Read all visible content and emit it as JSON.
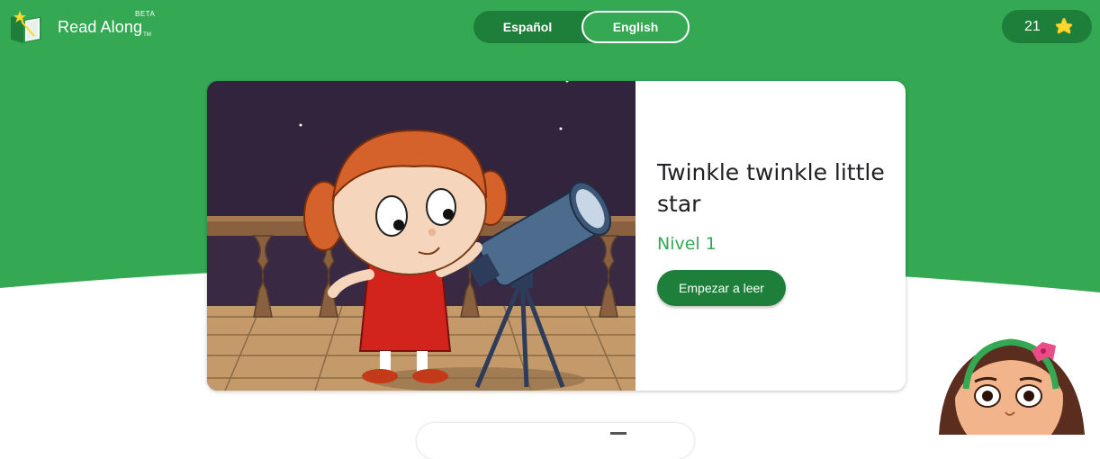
{
  "app": {
    "name": "Read Along",
    "trademark": "TM",
    "badge": "BETA"
  },
  "language_toggle": {
    "options": [
      "Español",
      "English"
    ],
    "selected": "English"
  },
  "stars": {
    "count": "21",
    "icon": "star-icon"
  },
  "story": {
    "title": "Twinkle twinkle little star",
    "level": "Nivel 1",
    "start_button": "Empezar a leer"
  },
  "colors": {
    "brand_green": "#34a853",
    "dark_green": "#1e7f3a",
    "star_yellow": "#fdd835"
  }
}
